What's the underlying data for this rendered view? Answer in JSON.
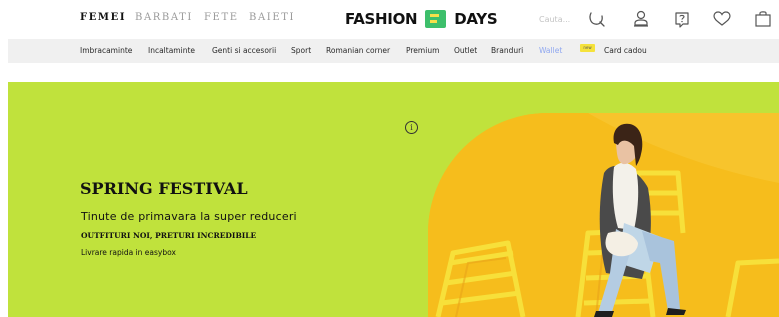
{
  "header": {
    "gender_tabs": [
      {
        "label": "FEMEI",
        "active": true
      },
      {
        "label": "BARBATI",
        "active": false
      },
      {
        "label": "FETE",
        "active": false
      },
      {
        "label": "BAIETI",
        "active": false
      }
    ],
    "logo": {
      "left": "FASHION",
      "right": "DAYS"
    },
    "search": {
      "placeholder": "Cauta..."
    },
    "icons": [
      "search-icon",
      "account-icon",
      "help-icon",
      "favorites-heart-icon",
      "cart-bag-icon"
    ]
  },
  "nav": {
    "items": [
      "Imbracaminte",
      "Incaltaminte",
      "Genti si accesorii",
      "Sport",
      "Romanian corner",
      "Premium",
      "Outlet",
      "Branduri",
      "Wallet",
      "Card cadou"
    ],
    "badge": "new"
  },
  "hero": {
    "title": "SPRING FESTIVAL",
    "subtitle": "Tinute de primavara la super reduceri",
    "tagline": "OUTFITURI NOI, PRETURI INCREDIBILE",
    "note": "Livrare rapida in easybox",
    "info_icon": "i"
  },
  "colors": {
    "hero_bg": "#c0e23c",
    "photo_bg": "#f6bd1c",
    "wallet_link": "#8fa7f0",
    "badge": "#f5e23b",
    "logo_mark": "#3dbf6b"
  }
}
